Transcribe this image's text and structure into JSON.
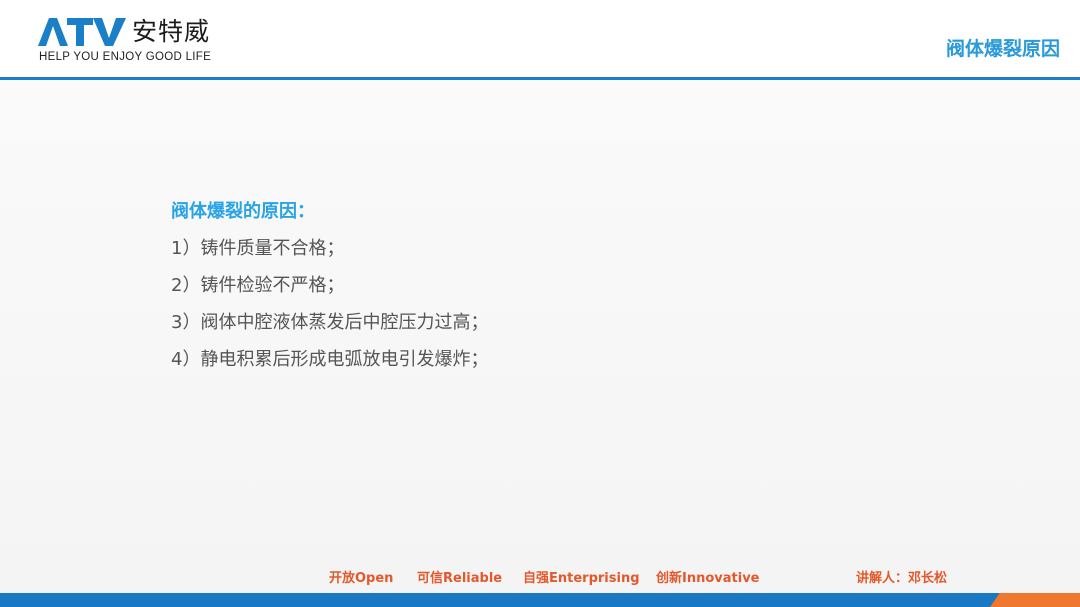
{
  "colors": {
    "brand_blue": "#1a7fc6",
    "heading_blue": "#29a3e6",
    "accent_orange": "#e4582b",
    "body_gray": "#555555"
  },
  "logo": {
    "mark": "ATV",
    "name_cn": "安特威",
    "tagline": "HELP YOU ENJOY GOOD LIFE"
  },
  "header": {
    "title": "阀体爆裂原因"
  },
  "content": {
    "heading": "阀体爆裂的原因：",
    "items": [
      "1）铸件质量不合格；",
      "2）铸件检验不严格；",
      "3）阀体中腔液体蒸发后中腔压力过高；",
      "4）静电积累后形成电弧放电引发爆炸；"
    ]
  },
  "footer": {
    "values": [
      "开放Open",
      "可信Reliable",
      "自强Enterprising",
      "创新Innovative"
    ],
    "speaker": "讲解人：邓长松"
  }
}
